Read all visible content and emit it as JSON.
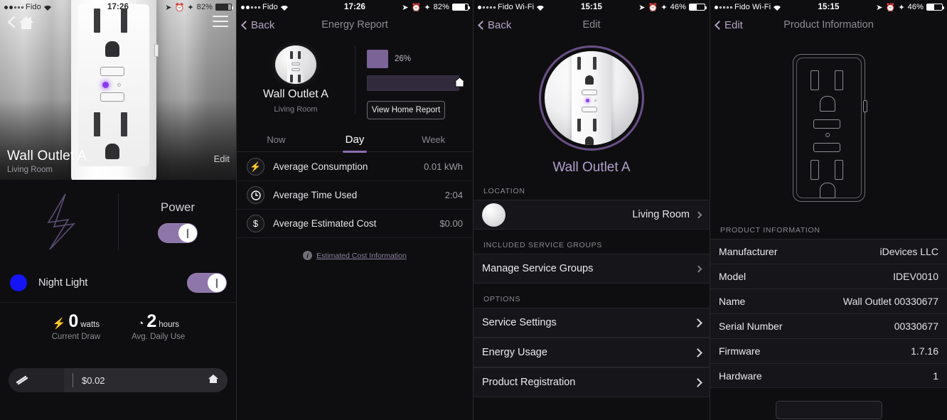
{
  "panels": [
    {
      "status": {
        "carrier": "Fido",
        "time": "17:26",
        "battery": "82%",
        "wifi_icon": "wifi-icon",
        "location_icon": "location-arrow-icon",
        "alarm_icon": "alarm-icon",
        "bluetooth_icon": "bluetooth-icon"
      },
      "nav": {
        "back_icon": "chevron-left-icon",
        "home_icon": "home-icon",
        "menu_icon": "hamburger-menu-icon"
      },
      "hero": {
        "title": "Wall Outlet A",
        "subtitle": "Living Room",
        "edit_label": "Edit"
      },
      "power": {
        "label": "Power",
        "toggle_state": "on",
        "toggle_glyph": "❙",
        "bolt_icon": "lightning-bolt-icon"
      },
      "nightlight": {
        "label": "Night Light",
        "color": "#1414f5",
        "toggle_state": "on",
        "toggle_glyph": "❙"
      },
      "stats": [
        {
          "icon": "lightning-bolt-icon",
          "value": "0",
          "unit": "watts",
          "caption": "Current Draw"
        },
        {
          "icon": "clock-icon",
          "value": "2",
          "unit": "hours",
          "caption": "Avg. Daily Use"
        }
      ],
      "cost_bar": {
        "lead_icon": "energy-icon",
        "value": "$0.02",
        "home_icon": "home-icon"
      }
    },
    {
      "status": {
        "carrier": "Fido",
        "time": "17:26",
        "battery": "82%"
      },
      "nav": {
        "back_label": "Back",
        "title": "Energy Report"
      },
      "device": {
        "name": "Wall Outlet A",
        "room": "Living Room",
        "thumb": "outlet-thumbnail"
      },
      "compare": {
        "device_pct": "26%",
        "device_pct_value": 26,
        "home_icon": "home-icon",
        "button_label": "View Home Report"
      },
      "segments": [
        {
          "label": "Now",
          "active": false
        },
        {
          "label": "Day",
          "active": true
        },
        {
          "label": "Week",
          "active": false
        }
      ],
      "rows": [
        {
          "icon": "lightning-bolt-icon",
          "glyph": "⚡",
          "label": "Average Consumption",
          "value": "0.01 kWh"
        },
        {
          "icon": "clock-icon",
          "glyph": "◕",
          "label": "Average Time Used",
          "value": "2:04"
        },
        {
          "icon": "dollar-icon",
          "glyph": "$",
          "label": "Average Estimated Cost",
          "value": "$0.00"
        }
      ],
      "footer": {
        "icon": "info-icon",
        "label": "Estimated Cost Information"
      }
    },
    {
      "status": {
        "carrier": "Fido Wi-Fi",
        "time": "15:15",
        "battery": "46%"
      },
      "nav": {
        "back_label": "Back",
        "title": "Edit"
      },
      "device": {
        "name": "Wall Outlet A",
        "image": "outlet-photo-ring"
      },
      "sections": [
        {
          "header": "LOCATION",
          "rows": [
            {
              "thumb": "room-thumbnail",
              "label": "",
              "value": "Living Room",
              "chevron": "chevron-right-icon"
            }
          ]
        },
        {
          "header": "INCLUDED SERVICE GROUPS",
          "rows": [
            {
              "label": "Manage Service Groups",
              "value": "",
              "chevron": "chevron-right-icon"
            }
          ]
        },
        {
          "header": "OPTIONS",
          "rows": [
            {
              "label": "Service Settings",
              "value": "",
              "chevron": "chevron-right-icon"
            },
            {
              "label": "Energy Usage",
              "value": "",
              "chevron": "chevron-right-icon"
            },
            {
              "label": "Product Registration",
              "value": "",
              "chevron": "chevron-right-icon"
            }
          ]
        }
      ]
    },
    {
      "status": {
        "carrier": "Fido Wi-Fi",
        "time": "15:15",
        "battery": "46%"
      },
      "nav": {
        "back_label": "Edit",
        "title": "Product Information"
      },
      "art": "outlet-line-drawing",
      "section_header": "PRODUCT INFORMATION",
      "rows": [
        {
          "key": "Manufacturer",
          "value": "iDevices LLC"
        },
        {
          "key": "Model",
          "value": "IDEV0010"
        },
        {
          "key": "Name",
          "value": "Wall Outlet 00330677"
        },
        {
          "key": "Serial Number",
          "value": "00330677"
        },
        {
          "key": "Firmware",
          "value": "1.7.16"
        },
        {
          "key": "Hardware",
          "value": "1"
        }
      ],
      "bottom_button": {
        "label": ""
      }
    }
  ],
  "theme": {
    "accent_purple": "#8b6fb0",
    "accent_purple_light": "#b3a0cf",
    "toggle_on": "#8e76ab",
    "nightlight_blue": "#1414f5",
    "background": "#0e0e10",
    "row_background": "#16161a"
  }
}
